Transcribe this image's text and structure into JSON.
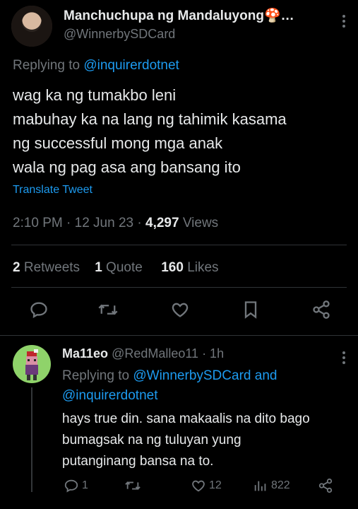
{
  "tweet": {
    "author_name": "Manchuchupa ng Mandaluyong🍄…",
    "author_handle": "@WinnerbySDCard",
    "replying_prefix": "Replying to",
    "replying_to": "@inquirerdotnet",
    "text_lines": [
      "wag ka ng tumakbo leni",
      "mabuhay ka na lang ng tahimik kasama",
      "ng successful mong mga anak",
      "wala ng pag asa ang bansang ito"
    ],
    "translate_label": "Translate Tweet",
    "time_date": "2:10 PM · 12 Jun 23 · ",
    "views_count": "4,297",
    "views_label": " Views",
    "retweets_count": "2",
    "retweets_label": " Retweets",
    "quotes_count": "1",
    "quotes_label": " Quote",
    "likes_count": "160",
    "likes_label": " Likes"
  },
  "reply": {
    "author_name": "Ma11eo",
    "author_handle": "@RedMalleo11 · 1h",
    "replying_prefix": "Replying to",
    "replying_to_1": "@WinnerbySDCard",
    "replying_and": " and",
    "replying_to_2": "@inquirerdotnet",
    "text_lines": [
      "hays true din. sana makaalis na dito bago",
      "bumagsak na ng tuluyan yung",
      "putanginang bansa na to."
    ],
    "reply_count": "1",
    "retweet_count": "",
    "like_count": "12",
    "views_count": "822"
  },
  "colors": {
    "background": "#000000",
    "text": "#e7e9ea",
    "muted": "#71767b",
    "link": "#1d9bf0",
    "divider": "#2f3336"
  }
}
